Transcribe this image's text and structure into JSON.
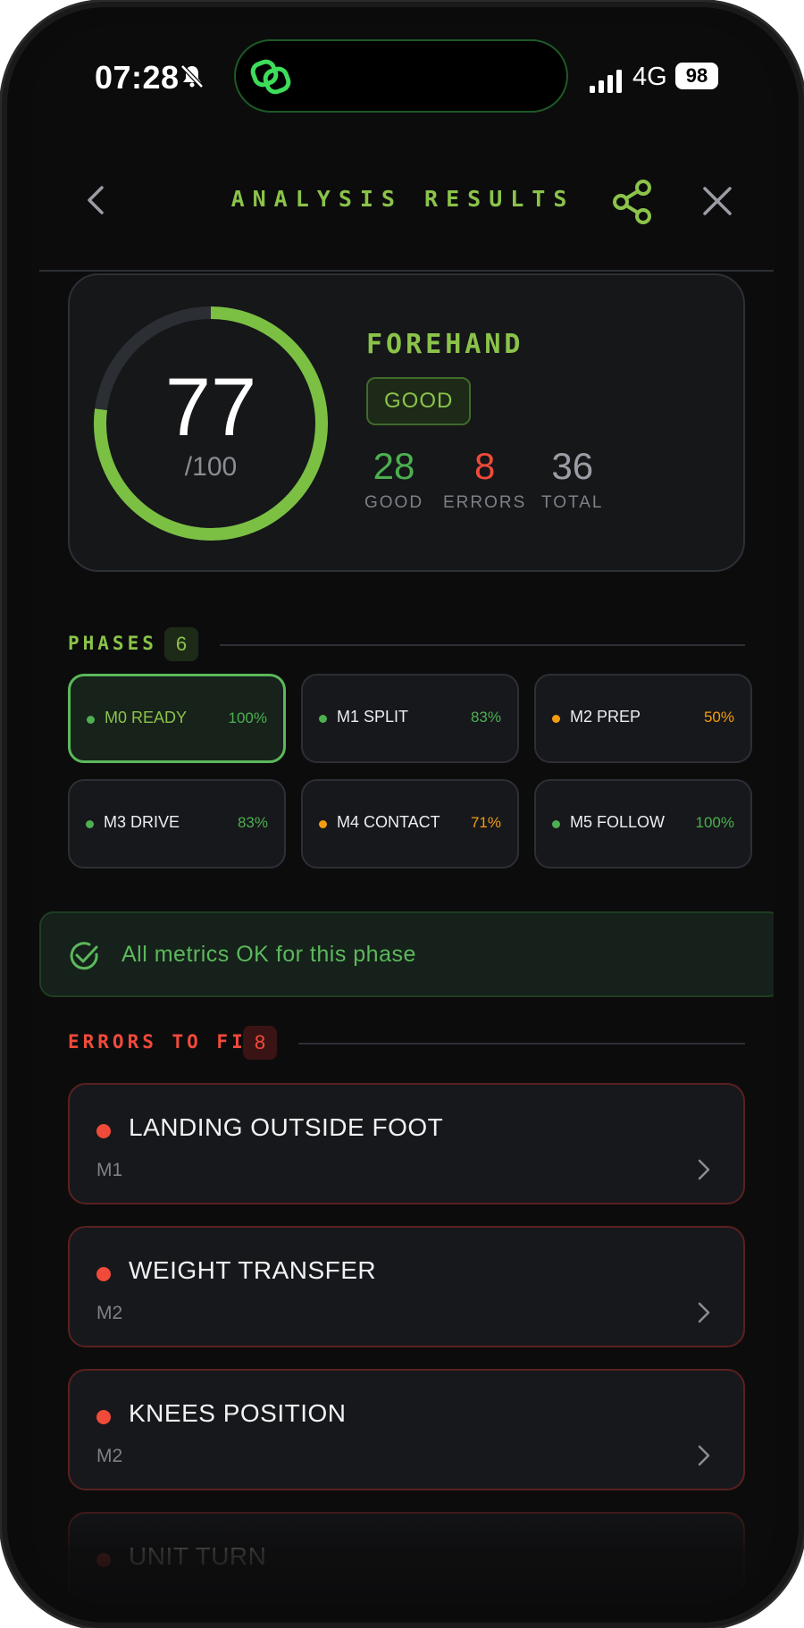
{
  "status_bar": {
    "time": "07:28",
    "network": "4G",
    "battery": "98"
  },
  "header": {
    "title": "ANALYSIS RESULTS"
  },
  "score": {
    "value": "77",
    "max": "/100",
    "fraction": 0.77
  },
  "stroke": {
    "name": "FOREHAND",
    "rating": "GOOD"
  },
  "stats": [
    {
      "value": "28",
      "label": "GOOD",
      "color": "#4caf50"
    },
    {
      "value": "8",
      "label": "ERRORS",
      "color": "#f04a3a"
    },
    {
      "value": "36",
      "label": "TOTAL",
      "color": "#9a9da4"
    }
  ],
  "phases_section": {
    "title": "PHASES",
    "count": "6"
  },
  "phases": [
    {
      "name": "M0 READY",
      "pct": "100%",
      "status": "green",
      "active": true
    },
    {
      "name": "M1 SPLIT",
      "pct": "83%",
      "status": "green",
      "active": false
    },
    {
      "name": "M2 PREP",
      "pct": "50%",
      "status": "orange",
      "active": false
    },
    {
      "name": "M3 DRIVE",
      "pct": "83%",
      "status": "green",
      "active": false
    },
    {
      "name": "M4 CONTACT",
      "pct": "71%",
      "status": "orange",
      "active": false
    },
    {
      "name": "M5 FOLLOW",
      "pct": "100%",
      "status": "green",
      "active": false
    }
  ],
  "ok_banner": {
    "text": "All metrics OK for this phase"
  },
  "errors_section": {
    "title": "ERRORS TO FIX",
    "count": "8"
  },
  "errors": [
    {
      "title": "LANDING OUTSIDE FOOT",
      "phase": "M1"
    },
    {
      "title": "WEIGHT TRANSFER",
      "phase": "M2"
    },
    {
      "title": "KNEES POSITION",
      "phase": "M2"
    },
    {
      "title": "UNIT TURN",
      "phase": ""
    }
  ],
  "colors": {
    "accent": "#8bc34a",
    "good": "#4caf50",
    "warning": "#f39c12",
    "error": "#f04a3a",
    "background": "#0c0c0d"
  }
}
